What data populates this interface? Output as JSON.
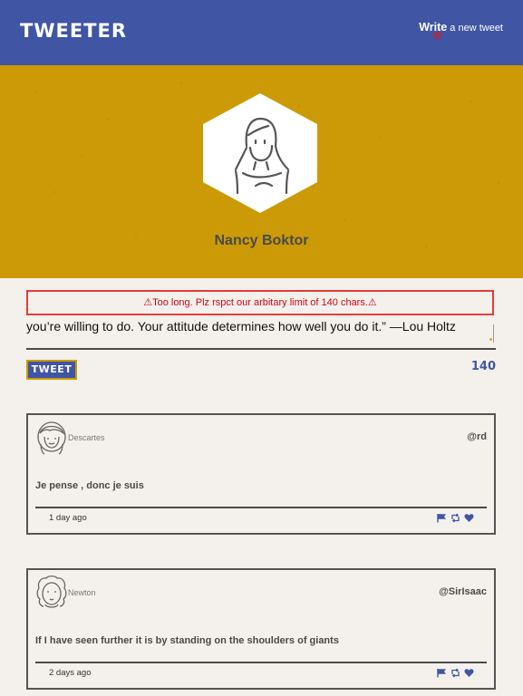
{
  "nav": {
    "brand": "TWEETER",
    "compose_write": "Write",
    "compose_rest": " a new tweet"
  },
  "profile": {
    "name": "Nancy Boktor"
  },
  "composer": {
    "error": "⚠Too long. Plz rspct our arbitary limit of 140 chars.⚠",
    "text": "you’re willing to do. Your attitude determines how well you do it.” —Lou Holtz",
    "button_label": "TWEET",
    "counter": "140"
  },
  "tweets": [
    {
      "user": "Descartes",
      "handle": "@rd",
      "content": "Je pense , donc je suis",
      "time": "1 day ago"
    },
    {
      "user": "Newton",
      "handle": "@SirIsaac",
      "content": "If I have seen further it is by standing on the shoulders of giants",
      "time": "2 days ago"
    }
  ],
  "colors": {
    "nav": "#4055a4",
    "header": "#cc9a06",
    "error": "#d0021b",
    "background": "#f4f1ec"
  },
  "icons": [
    "compose-chevron-icon",
    "flag-icon",
    "retweet-icon",
    "heart-icon"
  ]
}
